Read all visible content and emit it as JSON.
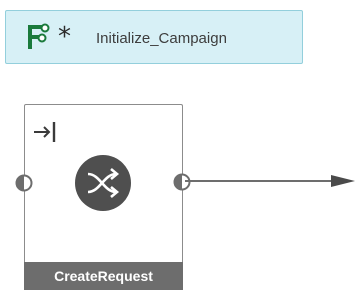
{
  "start_event": {
    "label": "Initialize_Campaign",
    "icon": "flow-start-icon",
    "marker": "*"
  },
  "activity": {
    "label": "CreateRequest",
    "entry_icon": "entry-arrow-icon",
    "type_icon": "shuffle-icon",
    "in_port_icon": "input-port-icon",
    "out_port_icon": "output-port-icon"
  },
  "colors": {
    "start_fill": "#d7f0f6",
    "start_border": "#93cfdc",
    "start_icon": "#1a7a3c",
    "activity_border": "#8c8c8c",
    "label_bar": "#6d6d6d",
    "type_icon_fill": "#4f4f4f",
    "connector": "#6d6d6d"
  }
}
